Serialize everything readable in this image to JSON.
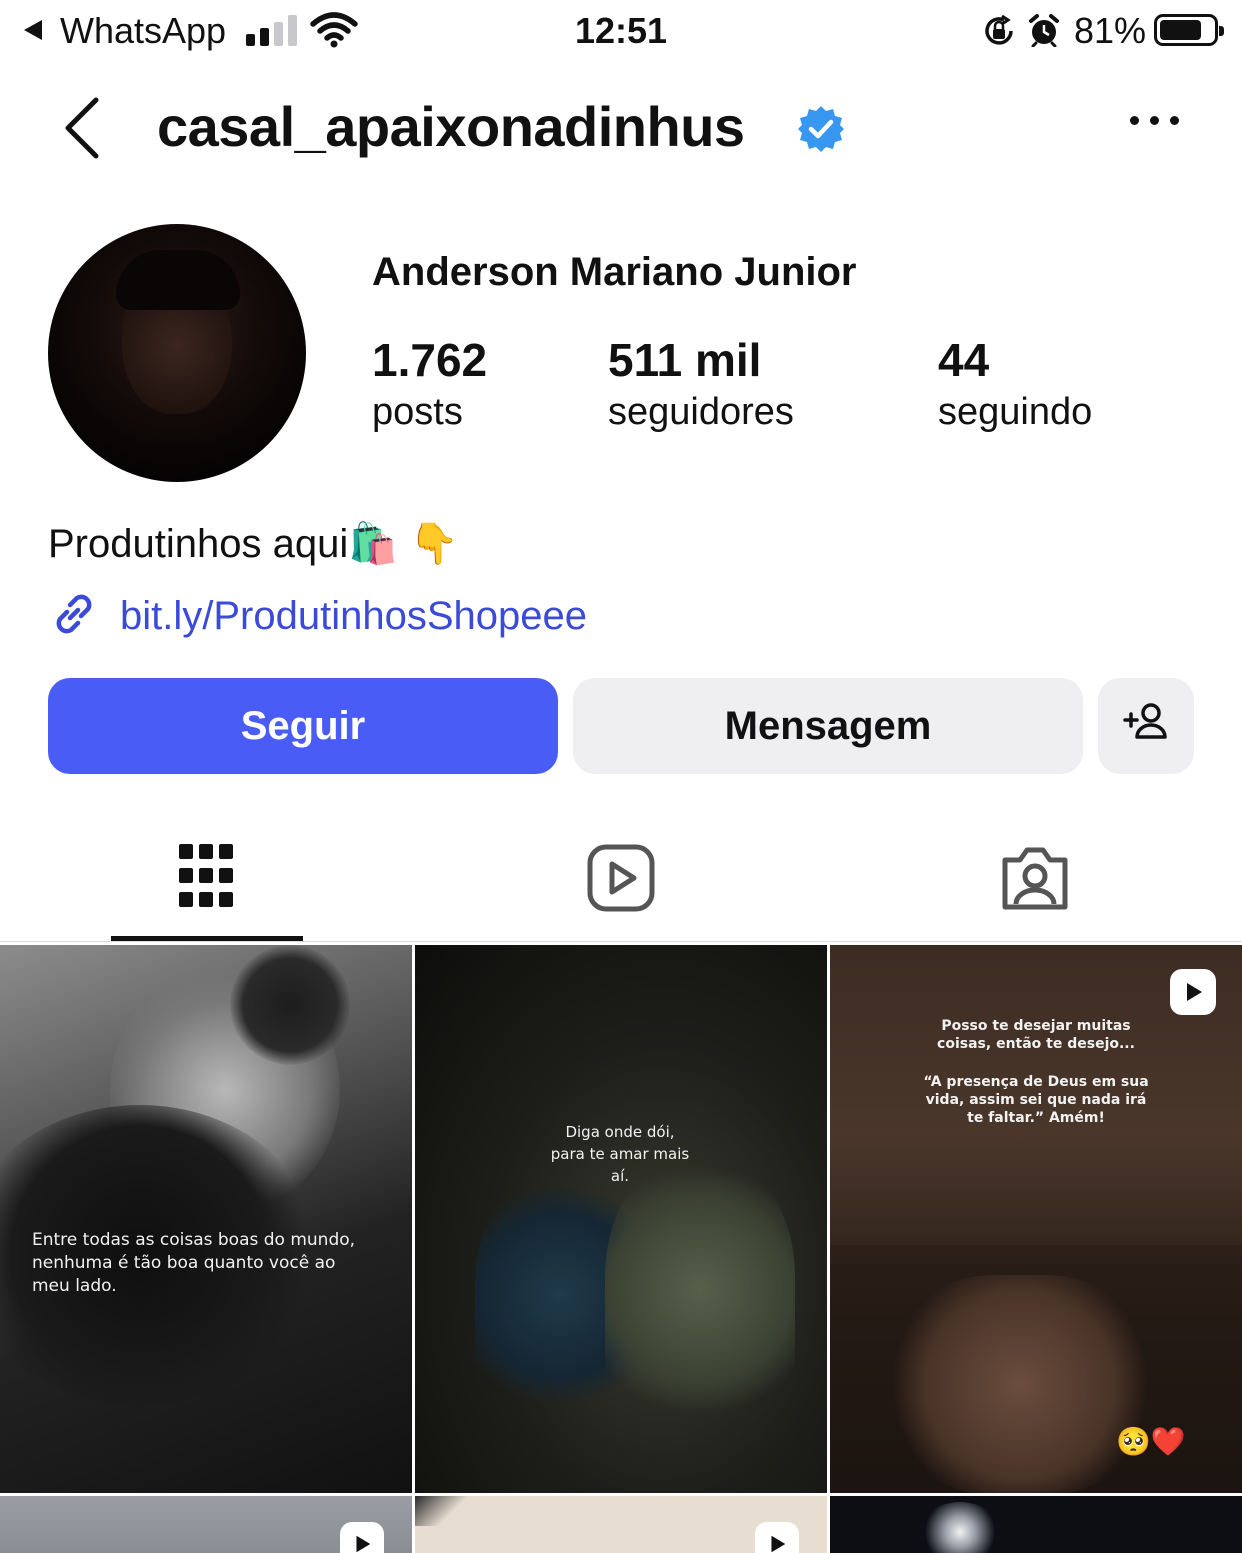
{
  "status_bar": {
    "back_app": "WhatsApp",
    "time": "12:51",
    "battery_percent": "81%",
    "signal_bars": 2,
    "icons": [
      "back-triangle-icon",
      "signal-icon",
      "wifi-icon",
      "rotation-lock-icon",
      "alarm-icon",
      "battery-icon"
    ]
  },
  "header": {
    "username": "casal_apaixonadinhus",
    "verified": true,
    "icons": [
      "back-chevron-icon",
      "verified-badge-icon",
      "more-options-icon"
    ]
  },
  "profile": {
    "display_name": "Anderson Mariano Junior",
    "stats": {
      "posts": {
        "value": "1.762",
        "label": "posts"
      },
      "followers": {
        "value": "511 mil",
        "label": "seguidores"
      },
      "following": {
        "value": "44",
        "label": "seguindo"
      }
    },
    "bio": "Produtinhos aqui🛍️ 👇",
    "link": "bit.ly/ProdutinhosShopeee"
  },
  "actions": {
    "follow": "Seguir",
    "message": "Mensagem",
    "suggest_icon": "add-person-icon"
  },
  "tabs": [
    {
      "name": "grid",
      "icon": "grid-icon",
      "active": true
    },
    {
      "name": "reels",
      "icon": "reels-icon",
      "active": false
    },
    {
      "name": "tagged",
      "icon": "tagged-icon",
      "active": false
    }
  ],
  "posts": [
    {
      "caption": "Entre todas as coisas boas do mundo, nenhuma é tão boa quanto você ao meu lado.",
      "reel": false
    },
    {
      "caption": "Diga onde dói, para te amar mais aí.",
      "reel": false
    },
    {
      "caption_1": "Posso te desejar muitas coisas, então te desejo...",
      "caption_2": "“A presença de Deus em sua vida, assim sei que nada irá te faltar.” Amém!",
      "emojis": "🥺❤️",
      "reel": true
    },
    {
      "reel": true
    },
    {
      "reel": true
    },
    {
      "reel": false
    }
  ],
  "colors": {
    "accent_blue": "#4a5cf6",
    "link_blue": "#3b4bd8",
    "verified_blue": "#3897f0",
    "button_gray": "#efeff2"
  }
}
